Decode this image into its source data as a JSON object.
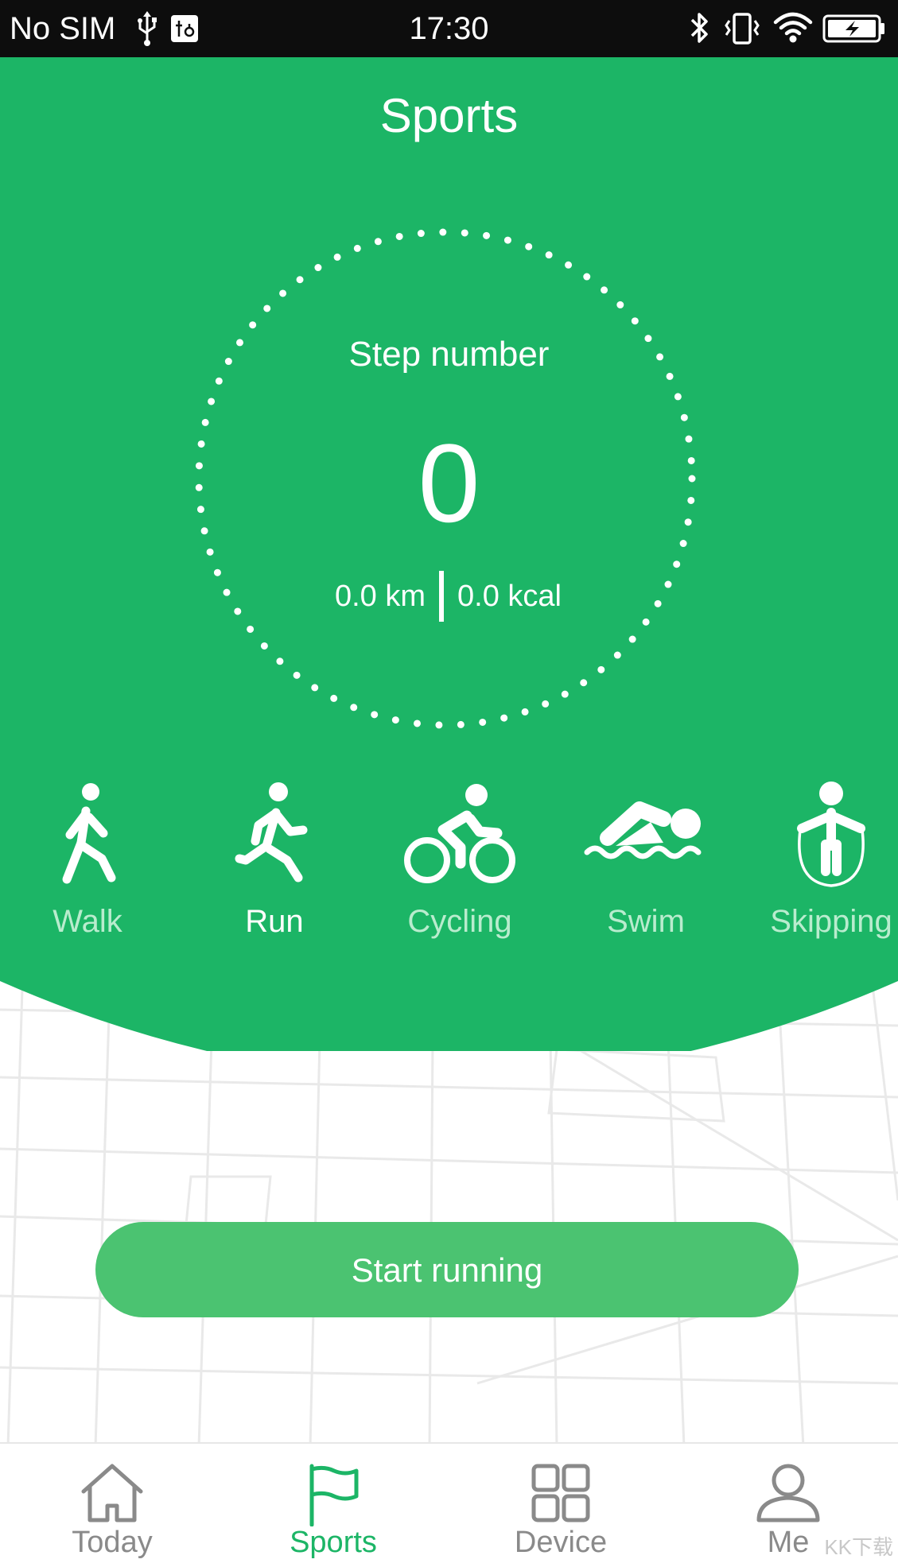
{
  "status_bar": {
    "carrier": "No SIM",
    "time": "17:30",
    "icons": [
      "usb-icon",
      "debug-icon",
      "bluetooth-icon",
      "vibrate-icon",
      "wifi-icon",
      "battery-charging-icon"
    ]
  },
  "header": {
    "title": "Sports"
  },
  "stats": {
    "step_label": "Step number",
    "step_value": "0",
    "distance": "0.0 km",
    "calories": "0.0 kcal"
  },
  "sport_modes": [
    {
      "label": "Walk",
      "icon": "walk-icon",
      "selected": false
    },
    {
      "label": "Run",
      "icon": "run-icon",
      "selected": true
    },
    {
      "label": "Cycling",
      "icon": "cycling-icon",
      "selected": false
    },
    {
      "label": "Swim",
      "icon": "swim-icon",
      "selected": false
    },
    {
      "label": "Skipping",
      "icon": "skipping-icon",
      "selected": false
    }
  ],
  "start_button": {
    "label": "Start running"
  },
  "bottom_nav": {
    "items": [
      {
        "label": "Today",
        "icon": "home-icon",
        "active": false
      },
      {
        "label": "Sports",
        "icon": "flag-icon",
        "active": true
      },
      {
        "label": "Device",
        "icon": "grid-icon",
        "active": false
      },
      {
        "label": "Me",
        "icon": "user-icon",
        "active": false
      }
    ]
  },
  "watermark": "KK下载",
  "colors": {
    "primary_green": "#1cb566",
    "button_green": "#4bc371",
    "inactive_sport_text": "#b9ecce",
    "status_bar_bg": "#0d0d0d",
    "nav_inactive": "#8a8a8a"
  }
}
